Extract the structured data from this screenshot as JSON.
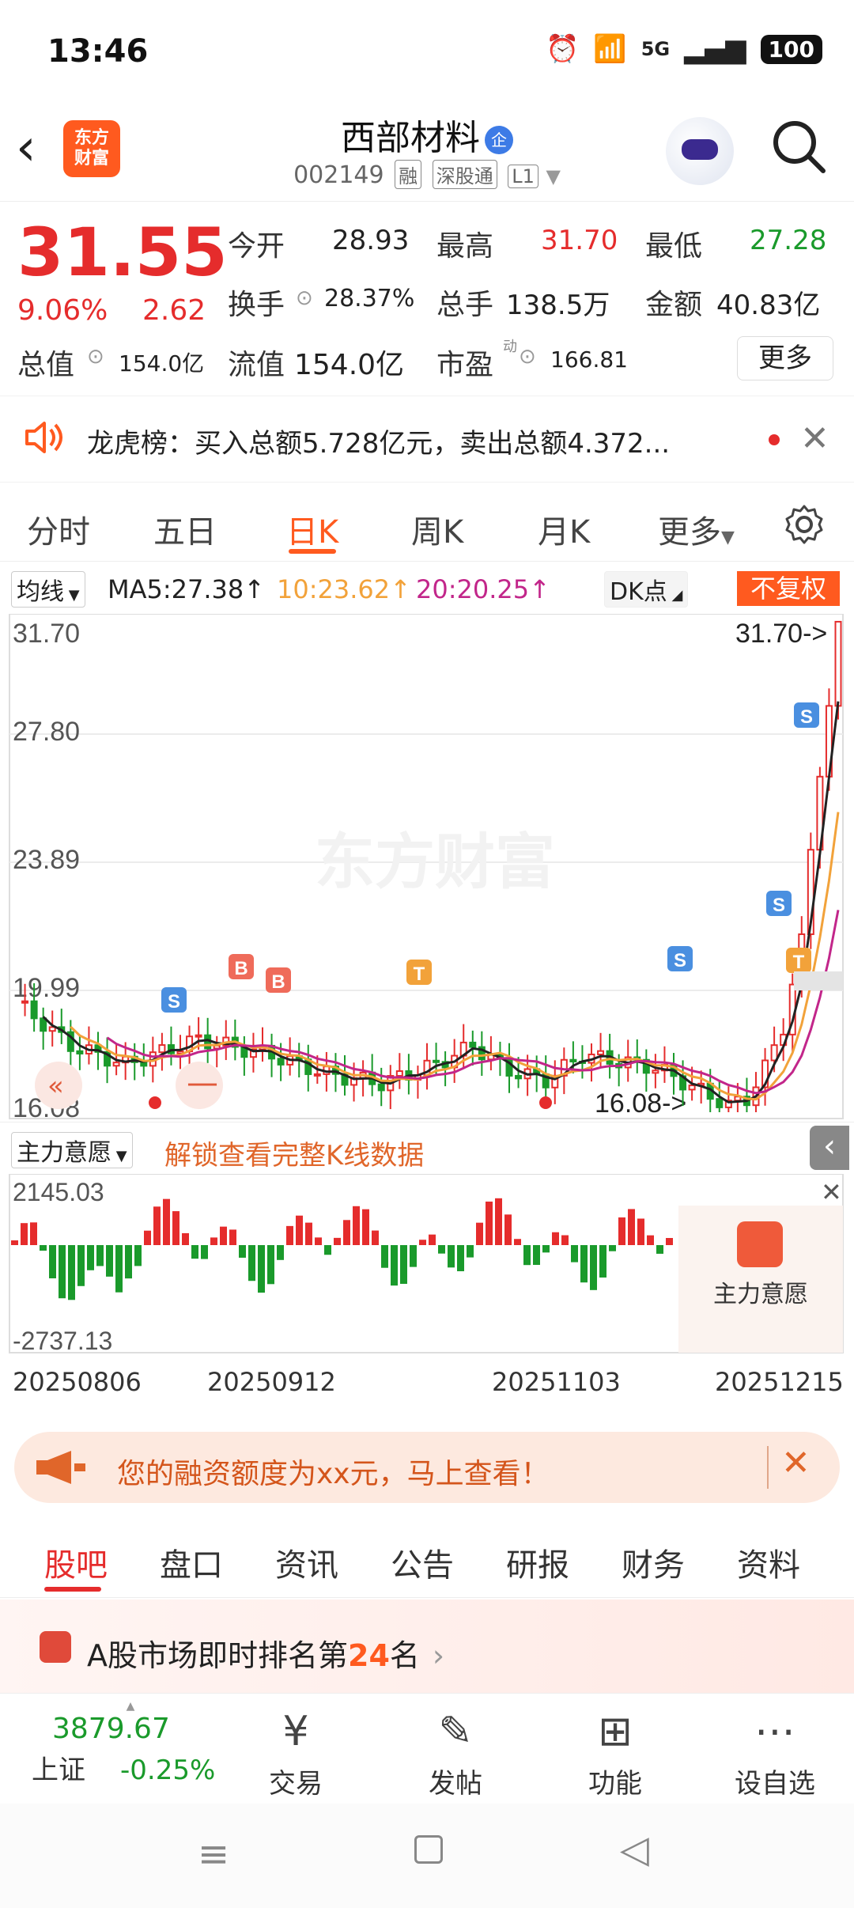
{
  "status_bar": {
    "time": "13:46",
    "network": "5G",
    "battery": "100"
  },
  "header": {
    "logo_line1": "东方",
    "logo_line2": "财富",
    "stock_name": "西部材料",
    "company_badge": "企",
    "stock_code": "002149",
    "tags": [
      "融",
      "深股通",
      "L1"
    ]
  },
  "quote": {
    "price": "31.55",
    "change_pct": "9.06%",
    "change": "2.62",
    "stats": [
      {
        "label": "今开",
        "value": "28.93"
      },
      {
        "label": "最高",
        "value": "31.70"
      },
      {
        "label": "最低",
        "value": "27.28"
      },
      {
        "label": "换手",
        "value": "28.37%"
      },
      {
        "label": "总手",
        "value": "138.5万"
      },
      {
        "label": "金额",
        "value": "40.83亿"
      },
      {
        "label": "总值",
        "value": "154.0亿"
      },
      {
        "label": "流值",
        "value": "154.0亿"
      },
      {
        "label": "市盈",
        "value": "166.81"
      }
    ],
    "pe_superscript": "动",
    "more_label": "更多"
  },
  "dragon_tiger": {
    "text": "龙虎榜：买入总额5.728亿元，卖出总额4.372..."
  },
  "chart_tabs": {
    "items": [
      "分时",
      "五日",
      "日K",
      "周K",
      "月K",
      "更多"
    ],
    "active": "日K"
  },
  "ma_row": {
    "selector": "均线",
    "ma5": "MA5:27.38↑",
    "ma10": "10:23.62↑",
    "ma20": "20:20.25↑",
    "dk": "DK点",
    "adjust": "不复权"
  },
  "chart_data": {
    "type": "candlestick",
    "y_ticks": [
      "31.70",
      "27.80",
      "23.89",
      "19.99",
      "16.08"
    ],
    "high_label": "31.70->",
    "low_label": "16.08->",
    "watermark": "东方财富",
    "markers": [
      "S",
      "B",
      "B",
      "T",
      "S",
      "S",
      "T",
      "S"
    ],
    "colors": {
      "up": "#e52c2c",
      "down": "#1a9a2b",
      "ma5": "#222222",
      "ma10": "#f2a23a",
      "ma20": "#c2268a"
    }
  },
  "main_force": {
    "selector": "主力意愿",
    "unlock": "解锁查看完整K线数据",
    "top": "2145.03",
    "bottom": "-2737.13",
    "badge": "主力意愿"
  },
  "date_axis": [
    "20250806",
    "20250912",
    "20251103",
    "20251215"
  ],
  "margin_banner": {
    "text": "您的融资额度为xx元，马上查看！"
  },
  "bottom_tabs": {
    "items": [
      "股吧",
      "盘口",
      "资讯",
      "公告",
      "研报",
      "财务",
      "资料"
    ],
    "active": "股吧"
  },
  "rank": {
    "prefix": "A股市场即时排名第",
    "number": "24",
    "suffix": "名"
  },
  "toolbar": {
    "index_value": "3879.67",
    "index_name": "上证",
    "index_change": "-0.25%",
    "items": [
      "交易",
      "发帖",
      "功能",
      "设自选"
    ]
  }
}
